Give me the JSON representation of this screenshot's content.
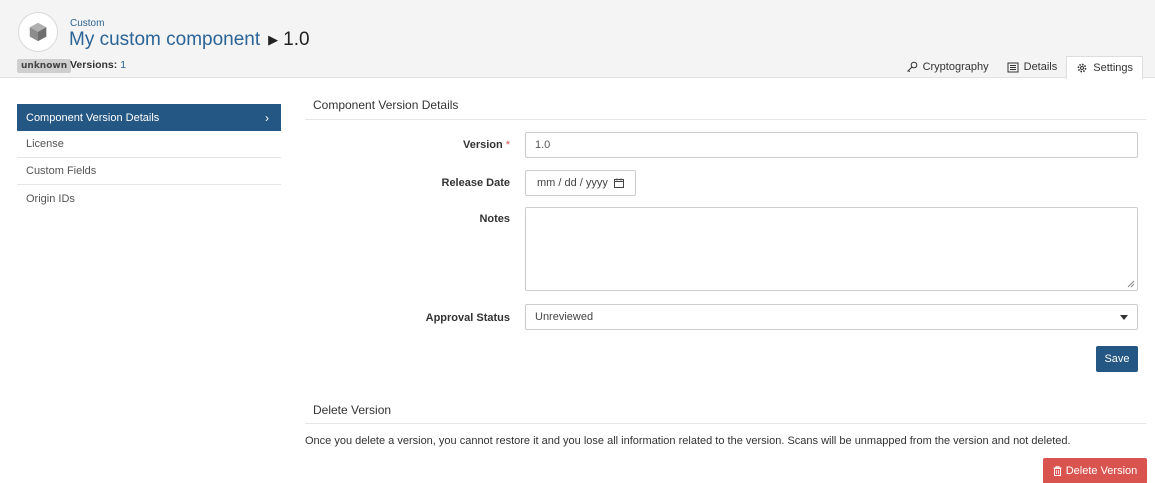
{
  "header": {
    "breadcrumb": "Custom",
    "component_name": "My custom component",
    "version": "1.0",
    "badge": "unknown",
    "versions_label": "Versions:",
    "versions_count": "1"
  },
  "tabs": [
    {
      "label": "Cryptography",
      "icon": "key-icon"
    },
    {
      "label": "Details",
      "icon": "details-icon"
    },
    {
      "label": "Settings",
      "icon": "gear-icon",
      "active": true
    }
  ],
  "sidebar": {
    "items": [
      {
        "label": "Component Version Details",
        "active": true
      },
      {
        "label": "License"
      },
      {
        "label": "Custom Fields"
      },
      {
        "label": "Origin IDs"
      }
    ]
  },
  "form": {
    "section_title": "Component Version Details",
    "version_label": "Version",
    "version_required_mark": "*",
    "version_value": "1.0",
    "release_date_label": "Release Date",
    "release_date_placeholder": "mm / dd / yyyy",
    "notes_label": "Notes",
    "notes_value": "",
    "approval_label": "Approval Status",
    "approval_value": "Unreviewed",
    "save_label": "Save"
  },
  "delete": {
    "section_title": "Delete Version",
    "description": "Once you delete a version, you cannot restore it and you lose all information related to the version. Scans will be unmapped from the version and not deleted.",
    "button_label": "Delete Version"
  },
  "colors": {
    "primary": "#245784",
    "link": "#2b6496",
    "danger": "#d9534f"
  }
}
